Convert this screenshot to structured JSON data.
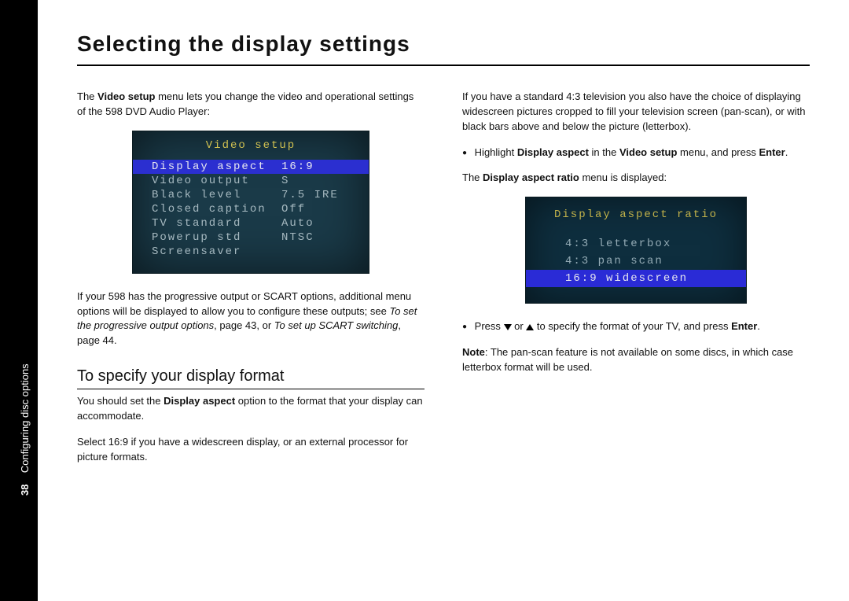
{
  "side": {
    "page_num": "38",
    "section": "Configuring disc options"
  },
  "title": "Selecting the display settings",
  "left": {
    "intro_pre": "The ",
    "intro_bold": "Video setup",
    "intro_post": " menu lets you change the video and operational settings of the 598 DVD Audio Player:",
    "osd1_title": "Video setup",
    "osd1_rows": [
      {
        "k": "Display aspect",
        "v": "16:9",
        "sel": true
      },
      {
        "k": "Video output",
        "v": "S"
      },
      {
        "k": "Black level",
        "v": "7.5 IRE"
      },
      {
        "k": "Closed caption",
        "v": "Off"
      },
      {
        "k": "TV standard",
        "v": "Auto"
      },
      {
        "k": "Powerup std",
        "v": "NTSC"
      },
      {
        "k": "Screensaver",
        "v": ""
      }
    ],
    "note_pre": "If your 598 has the progressive output or SCART options, additional menu options will be displayed to allow you to configure these outputs; see ",
    "note_ital1": "To set the progressive output options",
    "note_mid1": ", page 43, or ",
    "note_ital2": "To set up SCART switching",
    "note_mid2": ", page 44.",
    "subhead": "To specify your display format",
    "p2_pre": "You should set the ",
    "p2_bold": "Display aspect",
    "p2_post": " option to the format that your display can accommodate.",
    "p3": "Select 16:9 if you have a widescreen display, or an external processor for picture formats."
  },
  "right": {
    "p1": "If you have a standard 4:3 television you also have the choice of displaying widescreen pictures cropped to fill your television screen (pan-scan), or with black bars above and below the picture (letterbox).",
    "bullet1_pre": "Highlight ",
    "bullet1_bold1": "Display aspect",
    "bullet1_mid": " in the ",
    "bullet1_bold2": "Video setup",
    "bullet1_post": " menu, and press ",
    "bullet1_enter": "Enter",
    "bullet1_period": ".",
    "p2_pre": "The ",
    "p2_bold": "Display aspect ratio",
    "p2_post": " menu is displayed:",
    "osd2_title": "Display aspect ratio",
    "osd2_rows": [
      {
        "label": "4:3 letterbox"
      },
      {
        "label": "4:3 pan scan"
      },
      {
        "label": "16:9 widescreen",
        "sel": true
      }
    ],
    "bullet2_pre": "Press ",
    "bullet2_or": " or ",
    "bullet2_post": " to specify the format of your TV, and press ",
    "bullet2_enter": "Enter",
    "bullet2_period": ".",
    "note_pre": "Note",
    "note_post": ": The pan-scan feature is not available on some discs, in which case letterbox format will be used."
  }
}
